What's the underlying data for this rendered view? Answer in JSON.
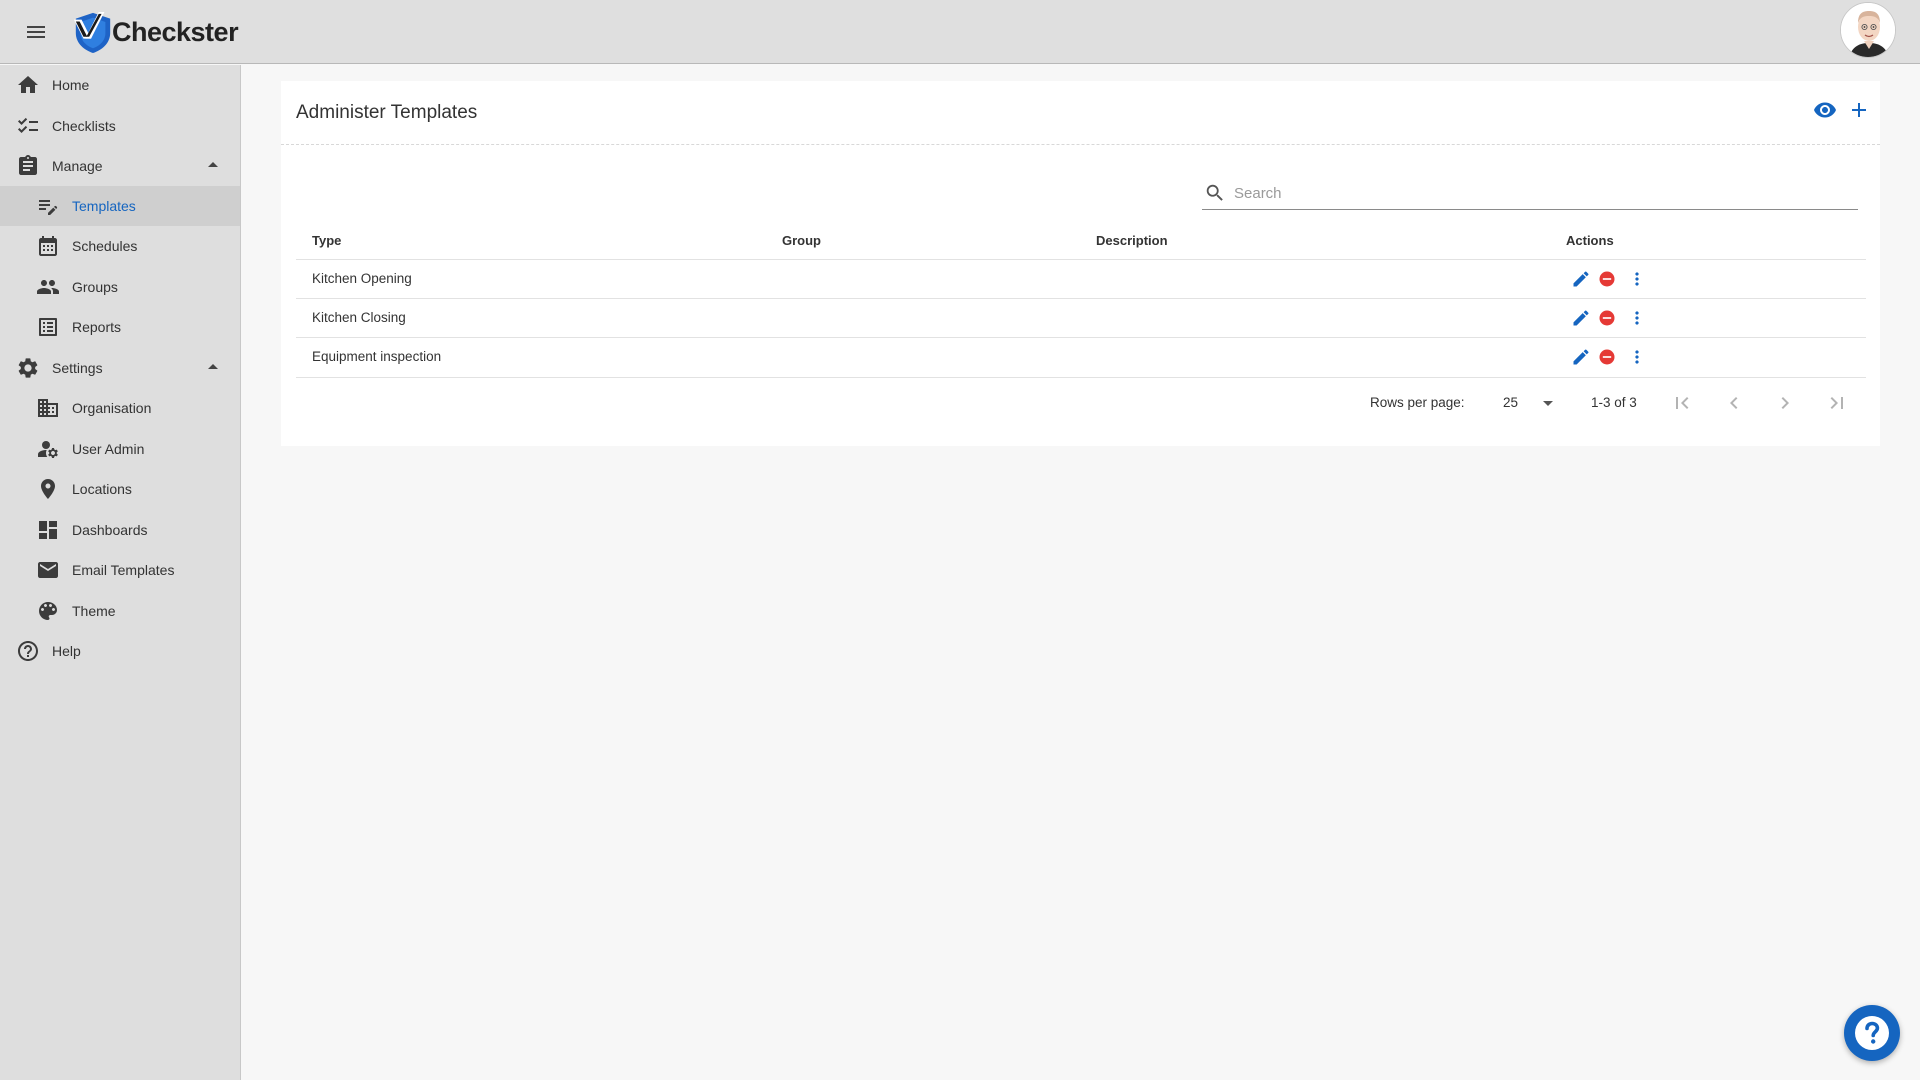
{
  "app": {
    "name": "Checkster"
  },
  "colors": {
    "accent": "#1565c0",
    "danger": "#e53935",
    "sidebar_bg": "#dedede",
    "topbar_bg": "#dfdfdf"
  },
  "sidebar": {
    "items": [
      {
        "label": "Home",
        "icon": "home-icon"
      },
      {
        "label": "Checklists",
        "icon": "checklist-icon"
      },
      {
        "label": "Manage",
        "icon": "clipboard-icon",
        "expanded": true
      },
      {
        "label": "Templates",
        "icon": "edit-note-icon",
        "active": true
      },
      {
        "label": "Schedules",
        "icon": "calendar-icon"
      },
      {
        "label": "Groups",
        "icon": "people-icon"
      },
      {
        "label": "Reports",
        "icon": "list-alt-icon"
      },
      {
        "label": "Settings",
        "icon": "gear-icon",
        "expanded": true
      },
      {
        "label": "Organisation",
        "icon": "building-icon"
      },
      {
        "label": "User Admin",
        "icon": "manage-accounts-icon"
      },
      {
        "label": "Locations",
        "icon": "location-pin-icon"
      },
      {
        "label": "Dashboards",
        "icon": "dashboard-icon"
      },
      {
        "label": "Email Templates",
        "icon": "mail-icon"
      },
      {
        "label": "Theme",
        "icon": "palette-icon"
      },
      {
        "label": "Help",
        "icon": "help-circle-icon"
      }
    ]
  },
  "main": {
    "title": "Administer Templates",
    "search": {
      "placeholder": "Search",
      "value": ""
    },
    "columns": [
      "Type",
      "Group",
      "Description",
      "Actions"
    ],
    "rows": [
      {
        "type": "Kitchen Opening",
        "group": "",
        "description": ""
      },
      {
        "type": "Kitchen Closing",
        "group": "",
        "description": ""
      },
      {
        "type": "Equipment inspection",
        "group": "",
        "description": ""
      }
    ],
    "pagination": {
      "rows_per_page_label": "Rows per page:",
      "rows_per_page": "25",
      "range": "1-3 of 3"
    }
  }
}
